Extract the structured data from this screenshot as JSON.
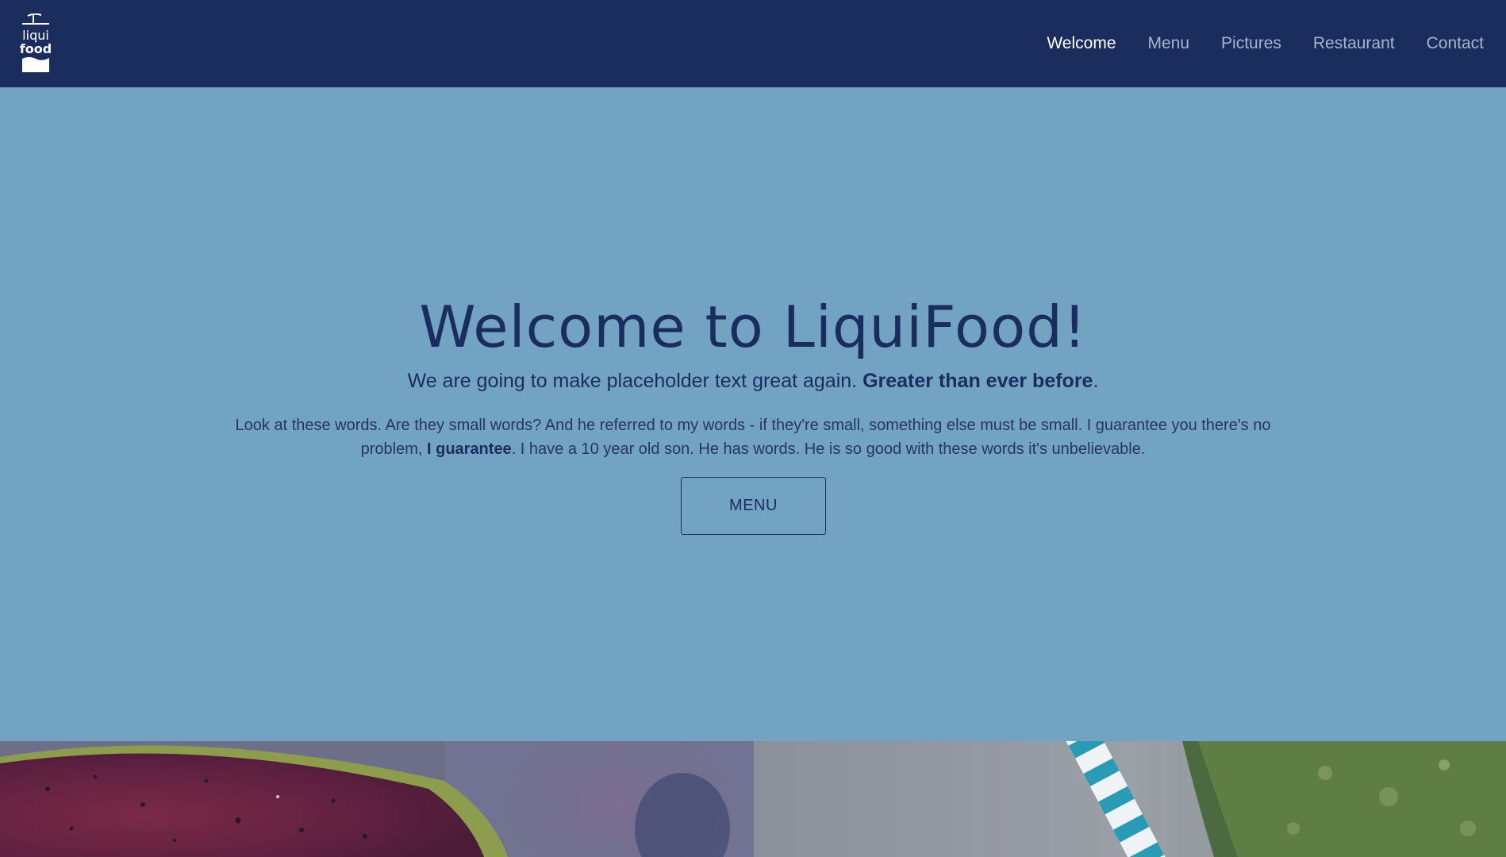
{
  "header": {
    "logo_text_top": "liqui",
    "logo_text_bottom": "food",
    "nav": [
      {
        "label": "Welcome",
        "active": true
      },
      {
        "label": "Menu",
        "active": false
      },
      {
        "label": "Pictures",
        "active": false
      },
      {
        "label": "Restaurant",
        "active": false
      },
      {
        "label": "Contact",
        "active": false
      }
    ]
  },
  "hero": {
    "title": "Welcome to LiquiFood!",
    "subtitle_plain": "We are going to make placeholder text great again. ",
    "subtitle_bold": "Greater than ever before",
    "subtitle_end": ".",
    "body_part1": "Look at these words. Are they small words? And he referred to my words - if they're small, something else must be small. I guarantee you there's no problem, ",
    "body_bold": "I guarantee",
    "body_part2": ". I have a 10 year old son. He has words. He is so good with these words it's unbelievable.",
    "button_label": "MENU"
  },
  "colors": {
    "header_bg": "#1b2d5d",
    "hero_bg": "#72a3c2",
    "nav_active": "#ffffff",
    "nav_inactive": "#a6b3cf",
    "text_primary": "#1b2d5d"
  }
}
